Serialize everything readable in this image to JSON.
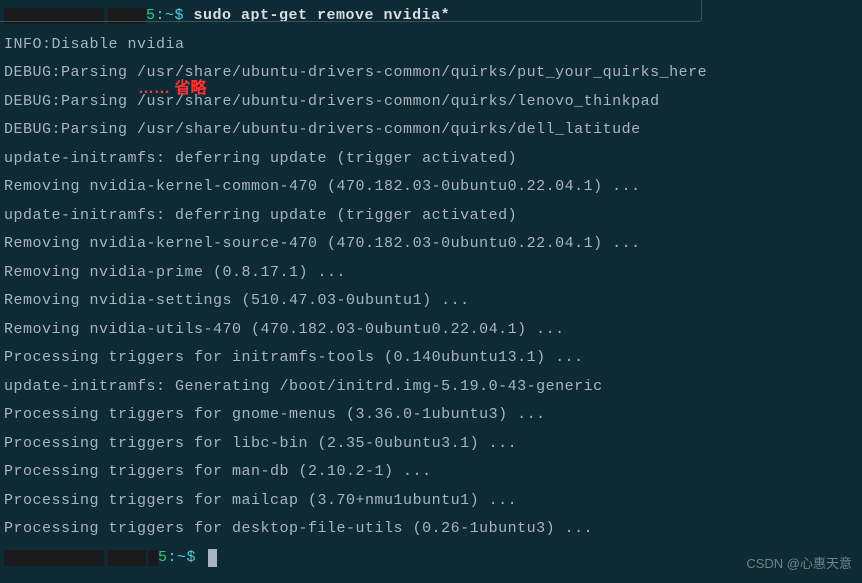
{
  "prompt1": {
    "suffix": "5",
    "path": ":~$ ",
    "command": "sudo apt-get remove nvidia*"
  },
  "lines": [
    "INFO:Disable nvidia",
    "DEBUG:Parsing /usr/share/ubuntu-drivers-common/quirks/put_your_quirks_here",
    "DEBUG:Parsing /usr/share/ubuntu-drivers-common/quirks/lenovo_thinkpad",
    "DEBUG:Parsing /usr/share/ubuntu-drivers-common/quirks/dell_latitude",
    "update-initramfs: deferring update (trigger activated)",
    "Removing nvidia-kernel-common-470 (470.182.03-0ubuntu0.22.04.1) ...",
    "update-initramfs: deferring update (trigger activated)",
    "Removing nvidia-kernel-source-470 (470.182.03-0ubuntu0.22.04.1) ...",
    "Removing nvidia-prime (0.8.17.1) ...",
    "Removing nvidia-settings (510.47.03-0ubuntu1) ...",
    "Removing nvidia-utils-470 (470.182.03-0ubuntu0.22.04.1) ...",
    "Processing triggers for initramfs-tools (0.140ubuntu13.1) ...",
    "update-initramfs: Generating /boot/initrd.img-5.19.0-43-generic",
    "Processing triggers for gnome-menus (3.36.0-1ubuntu3) ...",
    "Processing triggers for libc-bin (2.35-0ubuntu3.1) ...",
    "Processing triggers for man-db (2.10.2-1) ...",
    "Processing triggers for mailcap (3.70+nmu1ubuntu1) ...",
    "Processing triggers for desktop-file-utils (0.26-1ubuntu3) ..."
  ],
  "prompt2": {
    "suffix": "5",
    "path": ":~$ "
  },
  "annotation": "…… 省略",
  "watermark": "CSDN @心惠天意"
}
